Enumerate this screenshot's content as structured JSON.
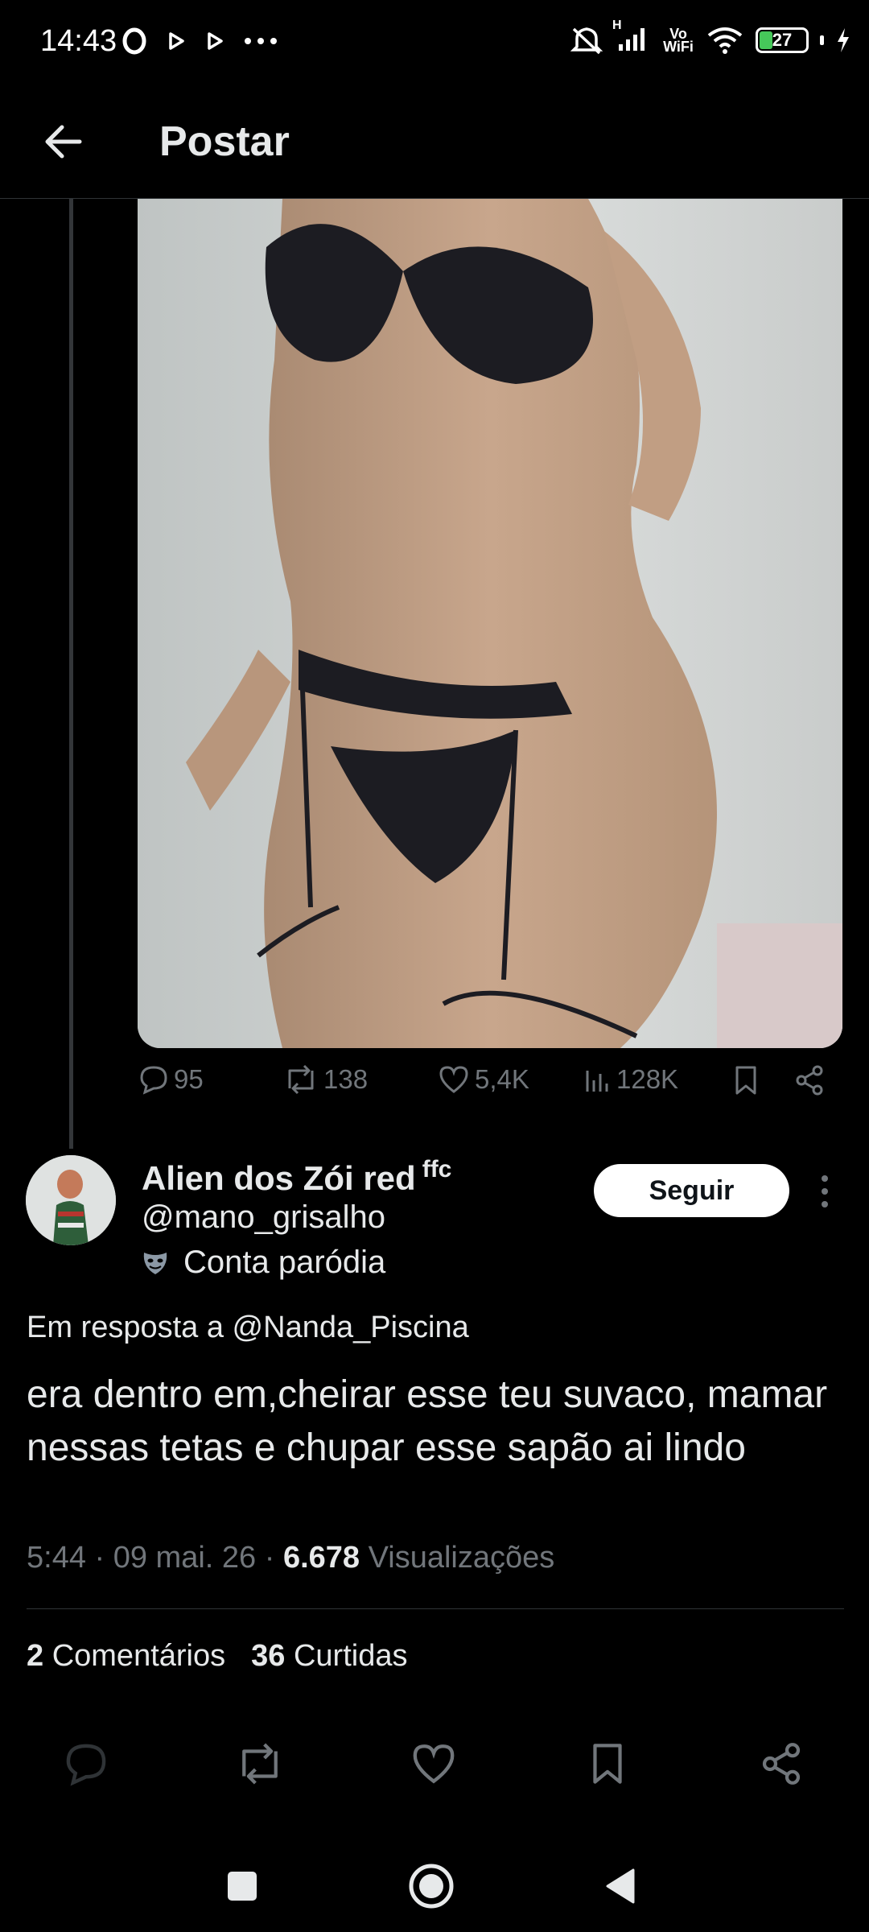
{
  "status_bar": {
    "time": "14:43",
    "wifi_label": "Vo WiFi",
    "signal_label": "H",
    "battery": "27",
    "icons": [
      "opera-icon",
      "play-icon",
      "play-icon",
      "more-dots-icon",
      "mute-icon",
      "signal-icon",
      "wifi-icon",
      "battery-icon",
      "charging-icon"
    ]
  },
  "header": {
    "title": "Postar",
    "back_icon": "arrow-left-icon"
  },
  "media_actions": {
    "comments": "95",
    "reposts": "138",
    "likes": "5,4K",
    "views": "128K"
  },
  "reply": {
    "author_name": "Alien dos Zói red",
    "author_suffix": "ffc",
    "author_handle": "@mano_grisalho",
    "parody_label": "Conta paródia",
    "follow_label": "Seguir",
    "reply_to": "Em resposta a @Nanda_Piscina",
    "text": "era dentro em,cheirar esse teu suvaco, mamar nessas tetas e chupar esse sapão ai lindo",
    "time": "5:44 · 09 mai. 26 · ",
    "views_count": "6.678",
    "views_label": " Visualizações",
    "comments_count": "2",
    "comments_label": " Comentários",
    "likes_count": "36",
    "likes_label": " Curtidas"
  },
  "colors": {
    "background": "#000000",
    "text": "#e7e9ea",
    "muted": "#71767b",
    "divider": "#2f3336",
    "follow_bg": "#ffffff"
  }
}
